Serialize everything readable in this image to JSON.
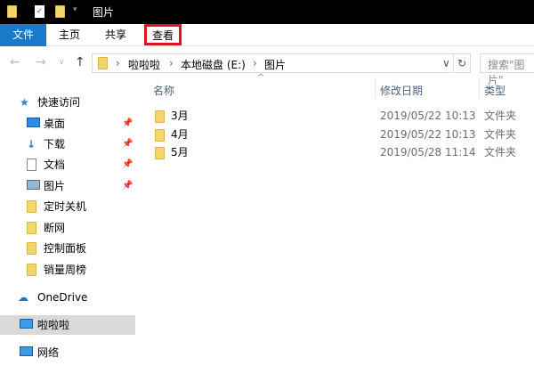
{
  "title": "图片",
  "ribbon": {
    "tabs": [
      "文件",
      "主页",
      "共享",
      "查看"
    ]
  },
  "address": {
    "parts": [
      "啦啦啦",
      "本地磁盘 (E:)",
      "图片"
    ],
    "search_placeholder": "搜索\"图片\""
  },
  "sidebar": {
    "quick_access": "快速访问",
    "items": [
      {
        "label": "桌面",
        "icon": "desktop-icon",
        "pinned": true
      },
      {
        "label": "下载",
        "icon": "download-icon",
        "pinned": true
      },
      {
        "label": "文档",
        "icon": "document-icon",
        "pinned": true
      },
      {
        "label": "图片",
        "icon": "picture-icon",
        "pinned": true
      },
      {
        "label": "定时关机",
        "icon": "folder-icon"
      },
      {
        "label": "断网",
        "icon": "folder-icon"
      },
      {
        "label": "控制面板",
        "icon": "folder-icon"
      },
      {
        "label": "销量周榜",
        "icon": "folder-icon"
      }
    ],
    "onedrive": "OneDrive",
    "thispc": "啦啦啦",
    "network": "网络"
  },
  "columns": [
    "名称",
    "修改日期",
    "类型"
  ],
  "files": [
    {
      "name": "3月",
      "date": "2019/05/22 10:13",
      "type": "文件夹"
    },
    {
      "name": "4月",
      "date": "2019/05/22 10:13",
      "type": "文件夹"
    },
    {
      "name": "5月",
      "date": "2019/05/28 11:14",
      "type": "文件夹"
    }
  ]
}
